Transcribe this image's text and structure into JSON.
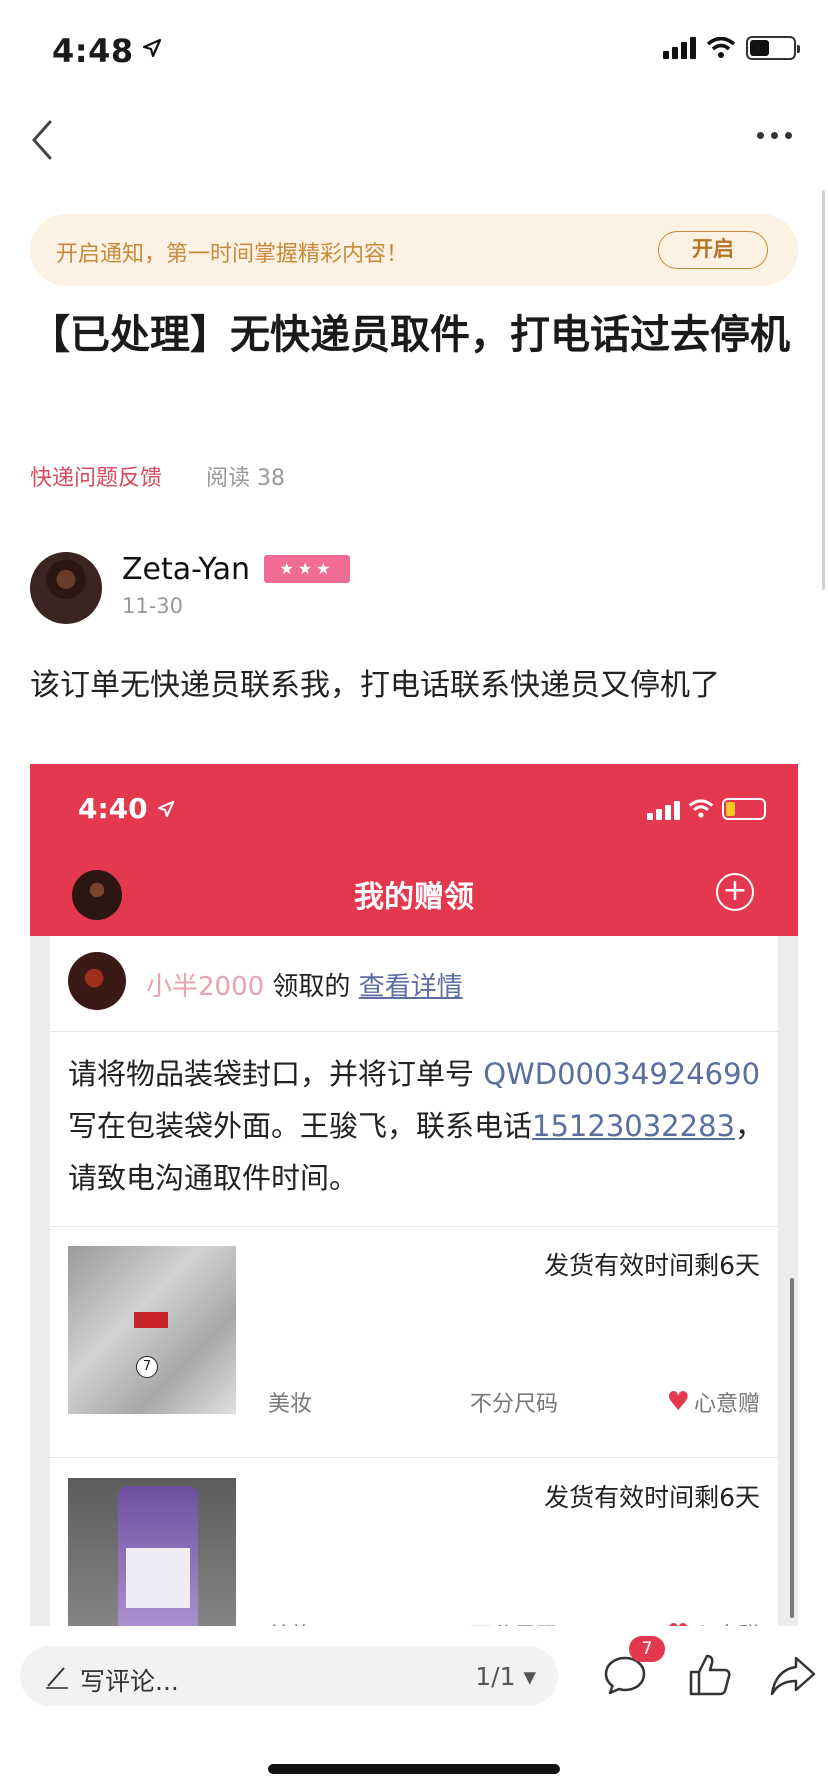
{
  "status_bar": {
    "time": "4:48"
  },
  "nav": {
    "back": "back-icon",
    "more": "more-icon"
  },
  "notification": {
    "text": "开启通知，第一时间掌握精彩内容！",
    "button": "开启"
  },
  "post": {
    "title": "【已处理】无快递员取件，打电话过去停机",
    "category": "快递问题反馈",
    "read_count": "阅读 38",
    "author": {
      "name": "Zeta-Yan",
      "badge": "★★★",
      "date": "11-30"
    },
    "body": "该订单无快递员联系我，打电话联系快递员又停机了"
  },
  "screenshot": {
    "time": "4:40",
    "title": "我的赠领",
    "plus": "+",
    "claimer": "小半2000",
    "claimed_text": " 领取的 ",
    "view_details": "查看详情",
    "msg_part1": "请将物品装袋封口，并将订单号 ",
    "order_no": "QWD00034924690",
    "msg_part2": " 写在包装袋外面。王骏飞，联系电话",
    "phone": "15123032283",
    "msg_part3": "，请致电沟通取件时间。",
    "items": [
      {
        "ship": "发货有效时间剩6天",
        "category": "美妆",
        "size": "不分尺码",
        "gift": "心意赠"
      },
      {
        "ship": "发货有效时间剩6天",
        "category": "美妆",
        "size": "不分尺码",
        "gift": "心意赠"
      }
    ]
  },
  "bottom_bar": {
    "comment_placeholder": "写评论...",
    "page_indicator": "1/1 ▾",
    "comment_count": "7"
  },
  "colors": {
    "accent": "#e4384f",
    "banner_bg": "#fdf1e3",
    "banner_text": "#c98a3b",
    "link": "#5a6ea2"
  }
}
